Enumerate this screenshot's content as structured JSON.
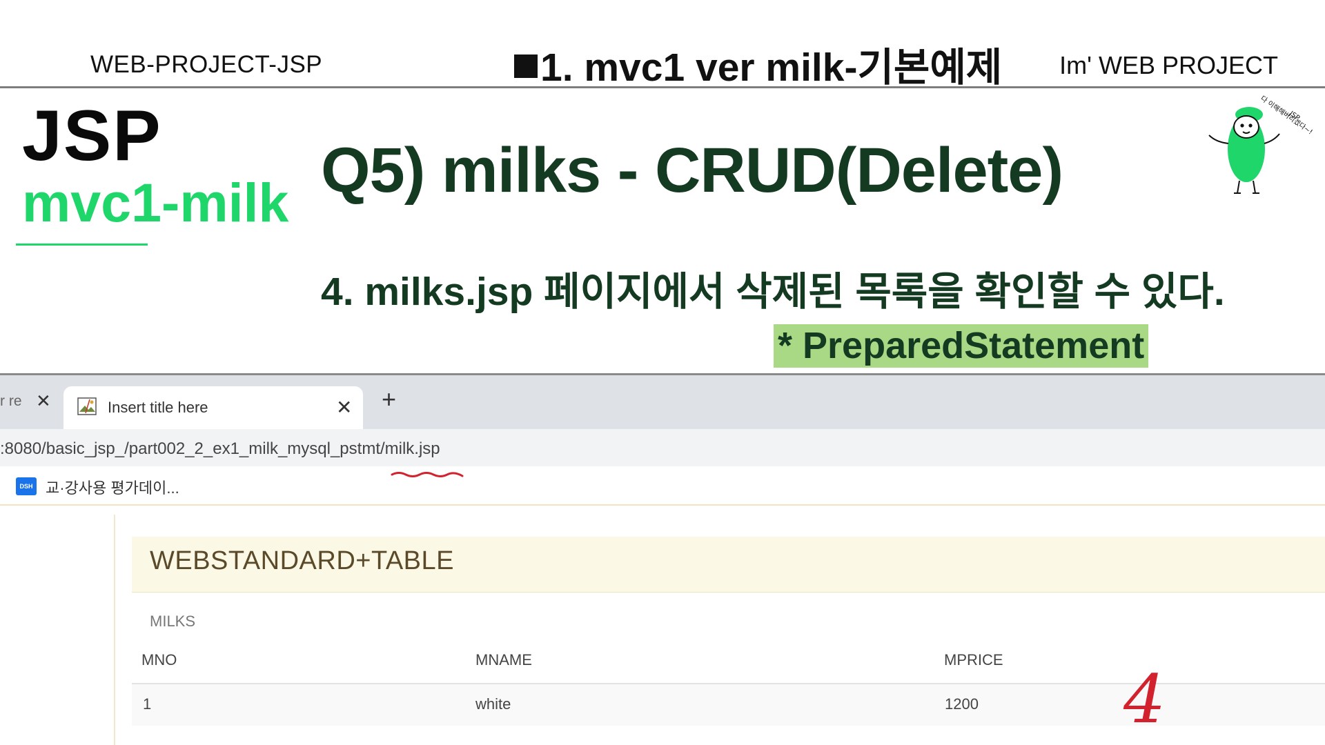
{
  "header": {
    "left": "WEB-PROJECT-JSP",
    "center": "1. mvc1 ver  milk-기본예제",
    "right": "Im'  WEB PROJECT"
  },
  "side": {
    "title": "JSP",
    "subtitle": "mvc1-milk"
  },
  "main": {
    "question": "Q5) milks - CRUD(Delete)",
    "step": "4. milks.jsp 페이지에서 삭제된 목록을 확인할 수 있다.",
    "note": "* PreparedStatement"
  },
  "mascot": {
    "icon": "mascot-icon",
    "caption_1": "JSP",
    "caption_2": "다 이해해버리겠다~!"
  },
  "colors": {
    "accent_green": "#1fd66a",
    "dark_green": "#143a22",
    "highlight": "#a9d985"
  },
  "browser": {
    "prev_tab_label": "r re",
    "active_tab_title": "Insert title here",
    "new_tab_label": "+",
    "url": ":8080/basic_jsp_/part002_2_ex1_milk_mysql_pstmt/milk.jsp",
    "bookmark_icon_label": "DSH",
    "bookmark_label": "교·강사용 평가데이...",
    "page": {
      "banner": "WEBSTANDARD+TABLE",
      "caption": "MILKS",
      "columns": [
        "MNO",
        "MNAME",
        "MPRICE"
      ],
      "rows": [
        [
          "1",
          "white",
          "1200"
        ]
      ]
    },
    "annotation": "4"
  }
}
